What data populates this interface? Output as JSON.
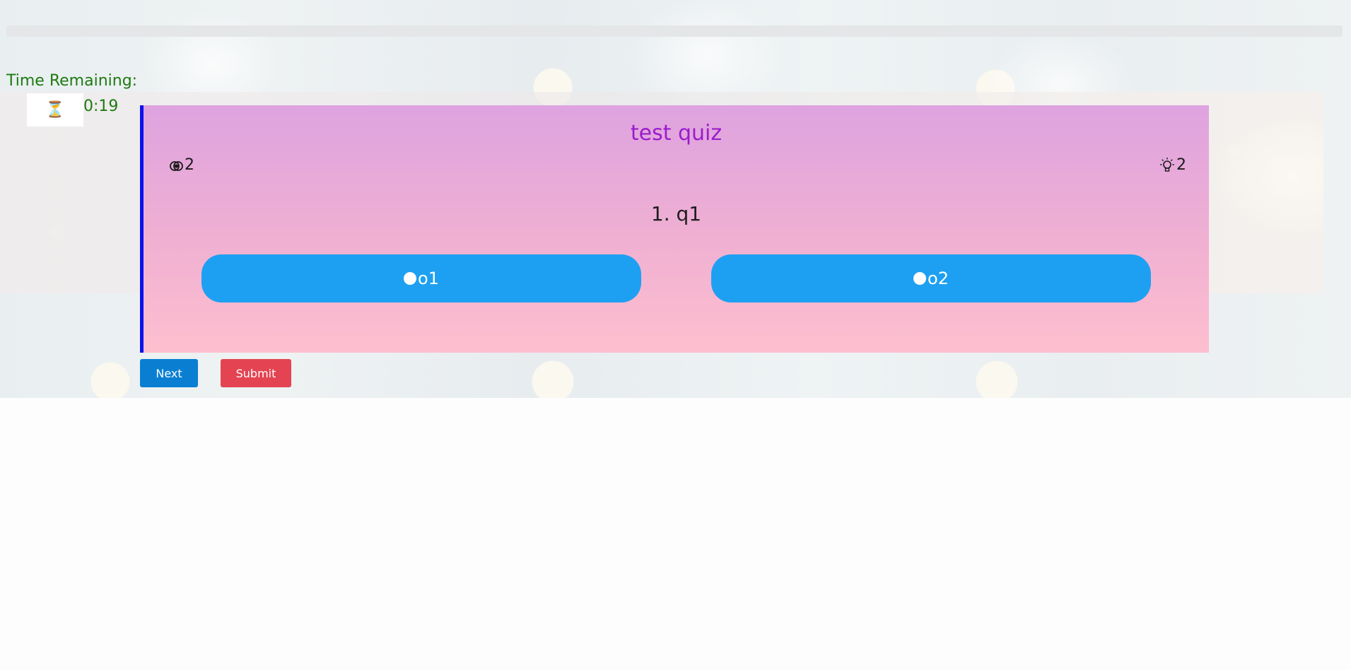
{
  "timer": {
    "label": "Time Remaining:",
    "icon": "hourglass-icon",
    "value": "0:19"
  },
  "quiz": {
    "title": "test quiz",
    "views_count": "2",
    "hints_count": "2",
    "question": "1. q1",
    "options": [
      {
        "label": "o1"
      },
      {
        "label": "o2"
      }
    ]
  },
  "actions": {
    "next_label": "Next",
    "submit_label": "Submit"
  },
  "colors": {
    "timer_text": "#1e7a12",
    "title": "#9b1ccc",
    "option_bg": "#1ea0f2",
    "next_bg": "#0a7fd2",
    "submit_bg": "#e44452",
    "card_border": "#0a12ee"
  }
}
